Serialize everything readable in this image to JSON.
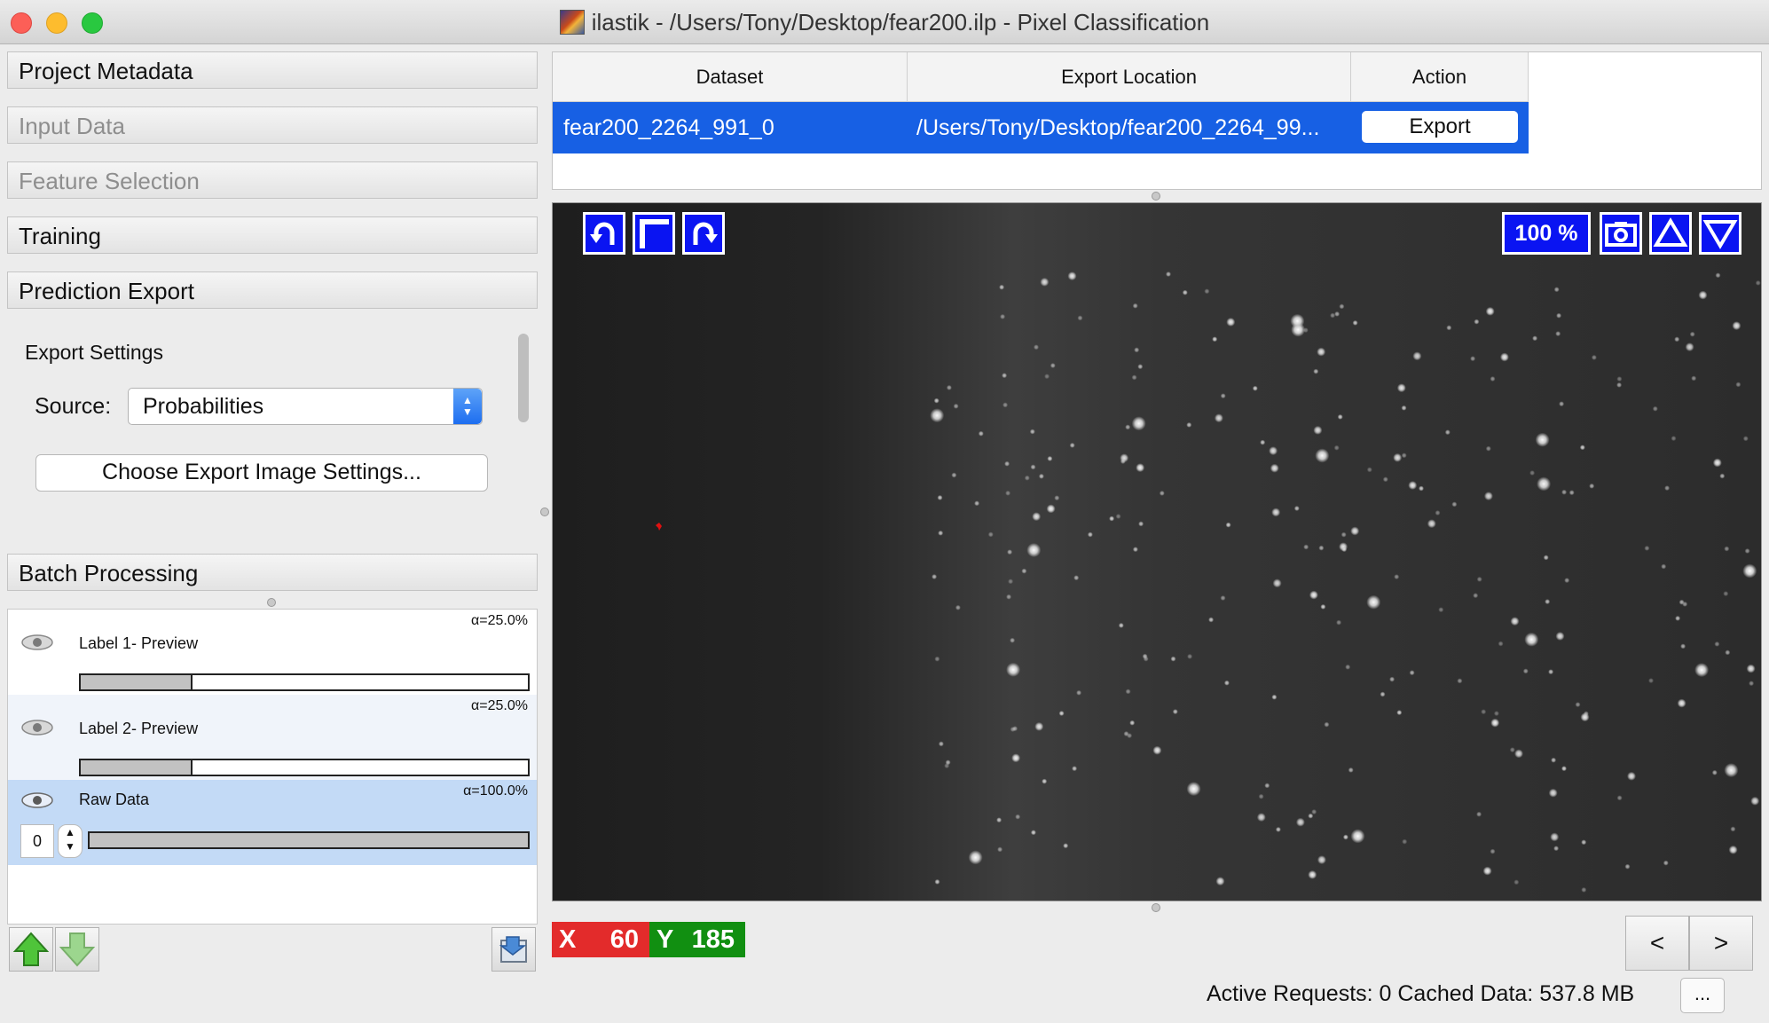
{
  "window": {
    "title": "ilastik - /Users/Tony/Desktop/fear200.ilp - Pixel Classification"
  },
  "applets": {
    "project_metadata": "Project Metadata",
    "input_data": "Input Data",
    "feature_selection": "Feature Selection",
    "training": "Training",
    "prediction_export": "Prediction Export",
    "batch_processing": "Batch Processing"
  },
  "export_settings": {
    "title": "Export Settings",
    "source_label": "Source:",
    "source_value": "Probabilities",
    "choose_button": "Choose Export Image Settings..."
  },
  "layers": [
    {
      "name": "Label 1- Preview",
      "alpha": "α=25.0%",
      "opacity": 0.25
    },
    {
      "name": "Label 2- Preview",
      "alpha": "α=25.0%",
      "opacity": 0.25
    },
    {
      "name": "Raw Data",
      "alpha": "α=100.0%",
      "opacity": 1.0,
      "channel": "0"
    }
  ],
  "table": {
    "headers": [
      "Dataset",
      "Export Location",
      "Action"
    ],
    "row": {
      "dataset": "fear200_2264_991_0",
      "location": "/Users/Tony/Desktop/fear200_2264_99...",
      "action": "Export"
    }
  },
  "viewer": {
    "zoom": "100 %"
  },
  "position": {
    "x_label": "X",
    "x_value": "60",
    "y_label": "Y",
    "y_value": "185"
  },
  "navigation": {
    "prev": "<",
    "next": ">"
  },
  "status": {
    "text": "Active Requests: 0  Cached Data: 537.8 MB",
    "more": "..."
  },
  "colors": {
    "selection": "#1760e4",
    "viewer_button": "#0a14f2",
    "x_badge": "#e32b2b",
    "y_badge": "#118f11"
  },
  "icons": [
    "undo-icon",
    "crop-icon",
    "redo-icon",
    "camera-icon",
    "triangle-up-icon",
    "triangle-down-icon",
    "eye-icon",
    "arrow-up-icon",
    "arrow-down-icon",
    "import-icon"
  ]
}
